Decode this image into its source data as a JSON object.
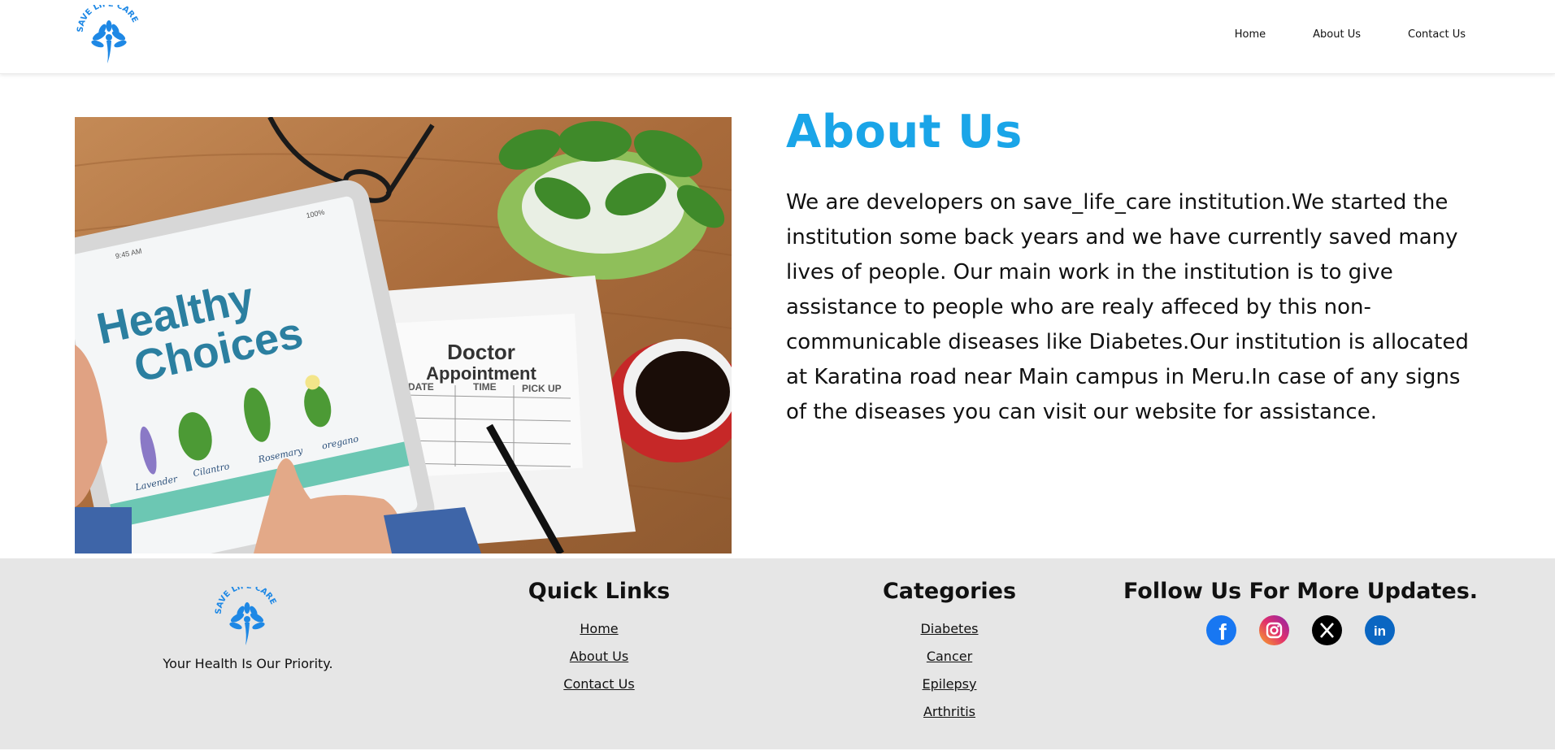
{
  "brand": {
    "logo_text": "SAVE LIFE CARE",
    "color": "#1e88e5"
  },
  "nav": [
    {
      "label": "Home"
    },
    {
      "label": "About Us"
    },
    {
      "label": "Contact Us"
    }
  ],
  "hero_image": {
    "tablet_title_1": "Healthy",
    "tablet_title_2": "Choices",
    "tablet_time": "9:45 AM",
    "tablet_battery": "100%",
    "herb_labels": [
      "Lavender",
      "Cilantro",
      "Rosemary",
      "oregano"
    ],
    "note_title_1": "Doctor",
    "note_title_2": "Appointment",
    "note_columns": [
      "DATE",
      "TIME",
      "PICK UP"
    ]
  },
  "about": {
    "title": "About Us",
    "text": "We are developers on save_life_care institution.We started the institution some back years and we have currently saved many lives of people. Our main work in the institution is to give assistance to people who are realy affeced by this non-communicable diseases like Diabetes.Our institution is allocated at Karatina road near Main campus in Meru.In case of any signs of the diseases you can visit our website for assistance.",
    "title_color": "#1aa5e8"
  },
  "footer": {
    "tagline": "Your Health Is Our Priority.",
    "quick_links": {
      "title": "Quick Links",
      "items": [
        "Home",
        "About Us",
        "Contact Us"
      ]
    },
    "categories": {
      "title": "Categories",
      "items": [
        "Diabetes",
        "Cancer",
        "Epilepsy",
        "Arthritis"
      ]
    },
    "follow": {
      "title": "Follow Us For More Updates.",
      "icons": [
        "facebook-icon",
        "instagram-icon",
        "x-icon",
        "linkedin-icon"
      ]
    },
    "background": "#e6e6e6"
  }
}
